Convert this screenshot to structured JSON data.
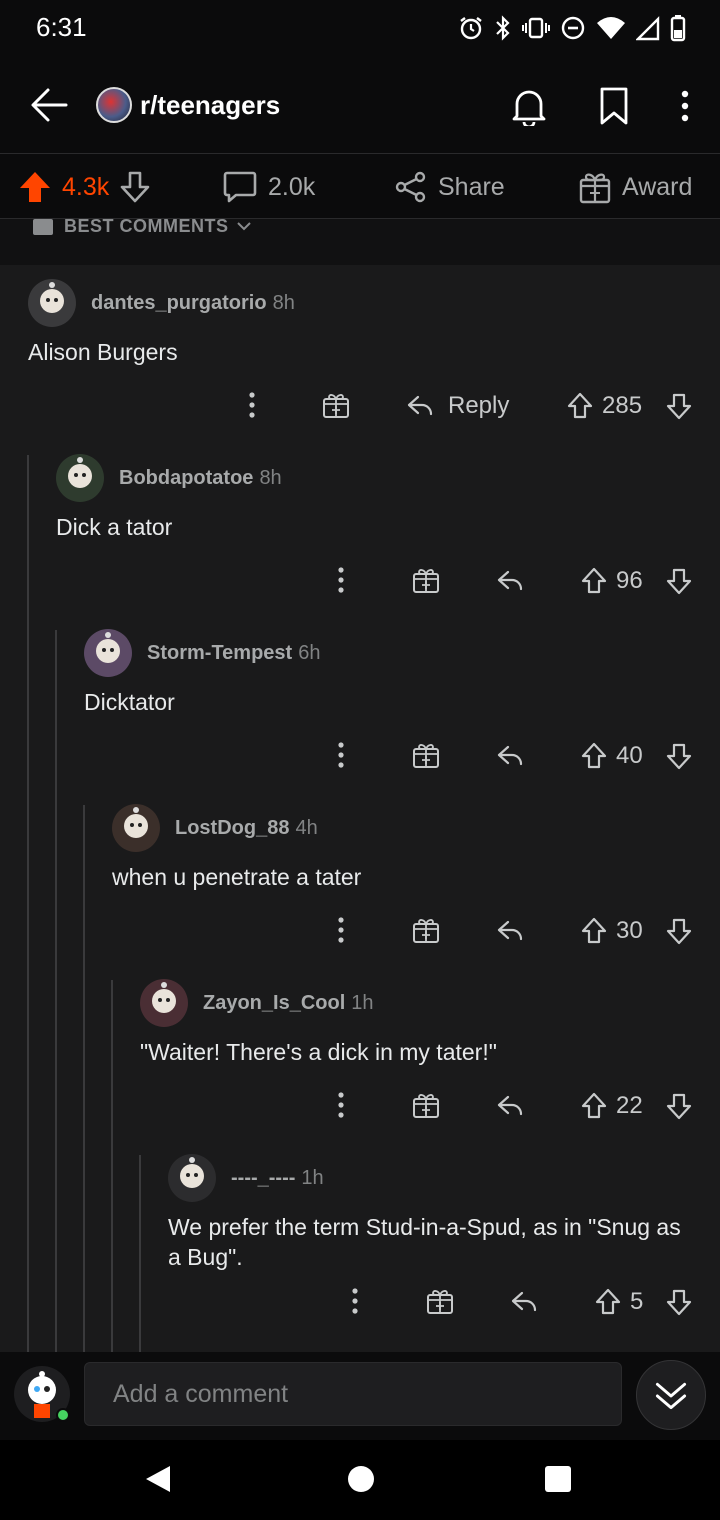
{
  "status_bar": {
    "time": "6:31"
  },
  "header": {
    "subreddit": "r/teenagers"
  },
  "post_actions": {
    "score": "4.3k",
    "comments": "2.0k",
    "share_label": "Share",
    "award_label": "Award"
  },
  "sort": {
    "label": "BEST COMMENTS"
  },
  "comments": [
    {
      "author": "dantes_purgatorio",
      "age": "8h",
      "body": "Alison Burgers",
      "score": "285",
      "reply_label": "Reply"
    },
    {
      "author": "Bobdapotatoe",
      "age": "8h",
      "body": "Dick a tator",
      "score": "96"
    },
    {
      "author": "Storm-Tempest",
      "age": "6h",
      "body": "Dicktator",
      "score": "40"
    },
    {
      "author": "LostDog_88",
      "age": "4h",
      "body": "when u penetrate a tater",
      "score": "30"
    },
    {
      "author": "Zayon_Is_Cool",
      "age": "1h",
      "body": "\"Waiter! There's a dick in my tater!\"",
      "score": "22"
    },
    {
      "author": "----_----",
      "age": "1h",
      "body": "We prefer the term Stud-in-a-Spud, as in \"Snug as a Bug\".",
      "score": "5"
    }
  ],
  "composer": {
    "placeholder": "Add a comment"
  },
  "colors": {
    "upvoted": "#ff4500",
    "background": "#1a1a1b",
    "online": "#46d160"
  },
  "icons": [
    "back-arrow-icon",
    "bell-icon",
    "bookmark-icon",
    "more-vert-icon",
    "upvote-icon",
    "downvote-icon",
    "comment-icon",
    "share-icon",
    "award-icon",
    "reply-icon",
    "collapse-icon"
  ]
}
